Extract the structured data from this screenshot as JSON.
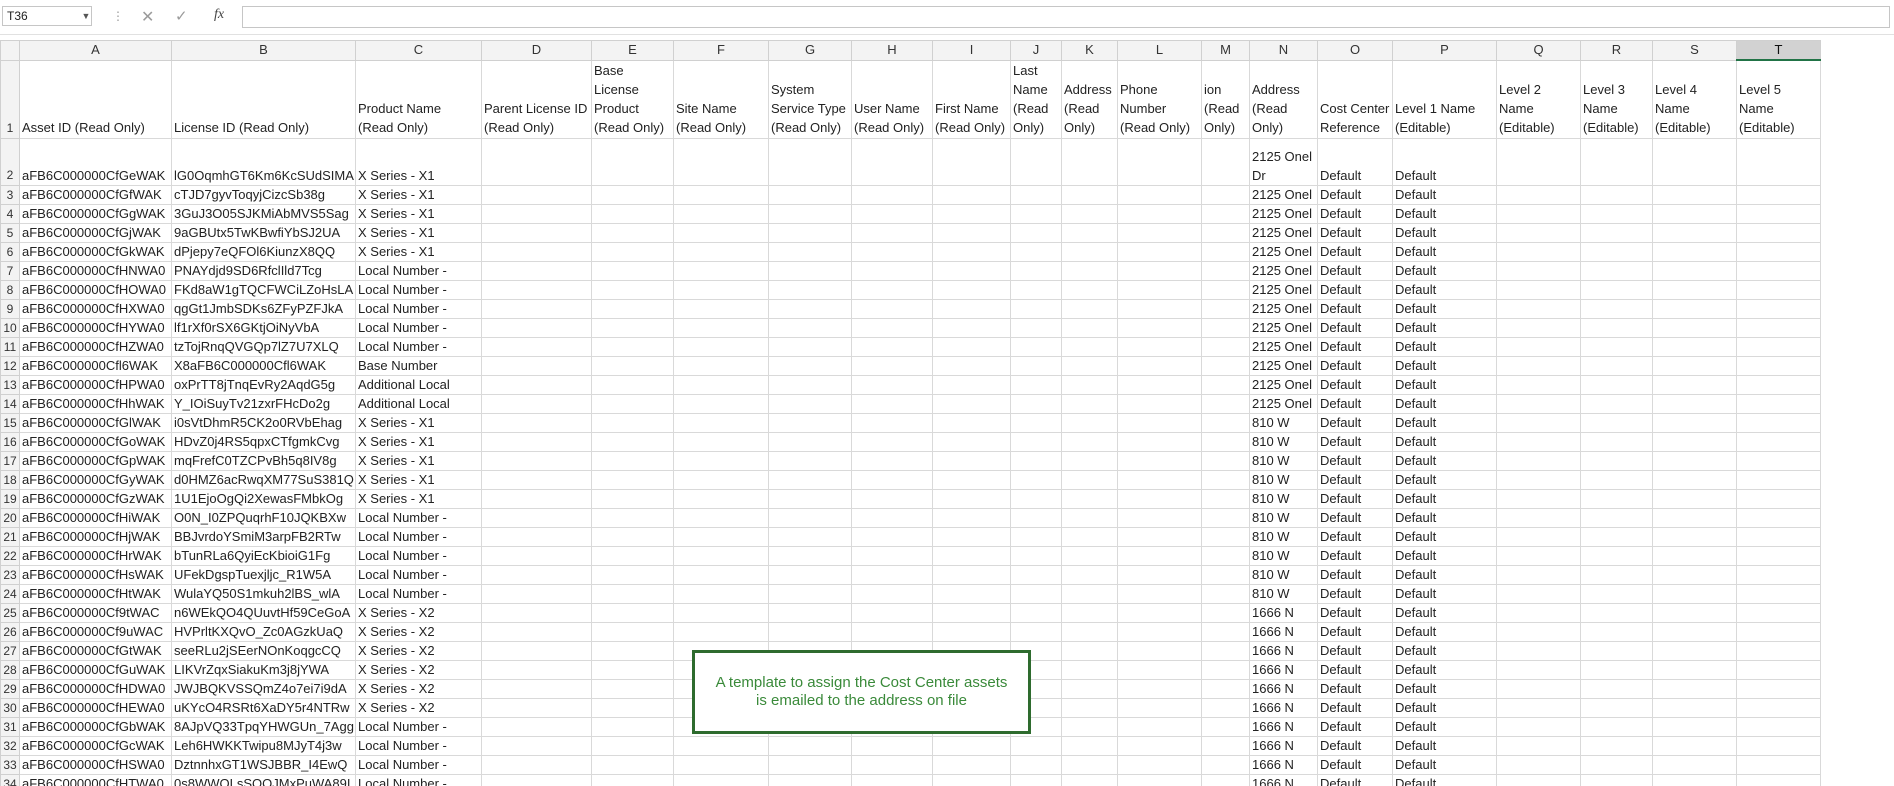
{
  "formula_bar": {
    "name_box": "T36",
    "separator": "⋮",
    "formula": ""
  },
  "icons": {
    "cancel": "close-icon",
    "enter": "check-icon",
    "function": "fx-icon"
  },
  "columns": [
    "A",
    "B",
    "C",
    "D",
    "E",
    "F",
    "G",
    "H",
    "I",
    "J",
    "K",
    "L",
    "M",
    "N",
    "O",
    "P",
    "Q",
    "R",
    "S",
    "T"
  ],
  "selected_column": "T",
  "headers": [
    "Asset ID (Read Only)",
    "License ID (Read Only)",
    "Product Name (Read Only)",
    "Parent License ID (Read Only)",
    "Base License Product (Read Only)",
    "Site Name (Read Only)",
    "System Service Type (Read Only)",
    "User Name (Read Only)",
    "First Name (Read Only)",
    "Last Name (Read Only)",
    "Address (Read Only)",
    "Phone Number (Read Only)",
    "ion (Read Only)",
    "Address (Read Only)",
    "Cost Center Reference",
    "Level 1 Name (Editable)",
    "Level 2 Name (Editable)",
    "Level 3 Name (Editable)",
    "Level 4 Name (Editable)",
    "Level 5 Name (Editable)"
  ],
  "rows": [
    {
      "n": "2",
      "a": "aFB6C000000CfGeWAK",
      "b": "lG0OqmhGT6Km6KcSUdSIMA",
      "c": "X Series - X1",
      "addr": "2125 Onel Dr",
      "cc": "Default",
      "l1": "Default"
    },
    {
      "n": "3",
      "a": "aFB6C000000CfGfWAK",
      "b": "cTJD7gyvToqyjCizcSb38g",
      "c": "X Series - X1",
      "addr": "2125 Onel",
      "cc": "Default",
      "l1": "Default"
    },
    {
      "n": "4",
      "a": "aFB6C000000CfGgWAK",
      "b": "3GuJ3O05SJKMiAbMVS5Sag",
      "c": "X Series - X1",
      "addr": "2125 Onel",
      "cc": "Default",
      "l1": "Default"
    },
    {
      "n": "5",
      "a": "aFB6C000000CfGjWAK",
      "b": "9aGBUtx5TwKBwfiYbSJ2UA",
      "c": "X Series - X1",
      "addr": "2125 Onel",
      "cc": "Default",
      "l1": "Default"
    },
    {
      "n": "6",
      "a": "aFB6C000000CfGkWAK",
      "b": "dPjepy7eQFOl6KiunzX8QQ",
      "c": "X Series - X1",
      "addr": "2125 Onel",
      "cc": "Default",
      "l1": "Default"
    },
    {
      "n": "7",
      "a": "aFB6C000000CfHNWA0",
      "b": "PNAYdjd9SD6RfclIld7Tcg",
      "c": "Local Number -",
      "addr": "2125 Onel",
      "cc": "Default",
      "l1": "Default"
    },
    {
      "n": "8",
      "a": "aFB6C000000CfHOWA0",
      "b": "FKd8aW1gTQCFWCiLZoHsLA",
      "c": "Local Number -",
      "addr": "2125 Onel",
      "cc": "Default",
      "l1": "Default"
    },
    {
      "n": "9",
      "a": "aFB6C000000CfHXWA0",
      "b": "qgGt1JmbSDKs6ZFyPZFJkA",
      "c": "Local Number -",
      "addr": "2125 Onel",
      "cc": "Default",
      "l1": "Default"
    },
    {
      "n": "10",
      "a": "aFB6C000000CfHYWA0",
      "b": "lf1rXf0rSX6GKtjOiNyVbA",
      "c": "Local Number -",
      "addr": "2125 Onel",
      "cc": "Default",
      "l1": "Default"
    },
    {
      "n": "11",
      "a": "aFB6C000000CfHZWA0",
      "b": "tzTojRnqQVGQp7lZ7U7XLQ",
      "c": "Local Number -",
      "addr": "2125 Onel",
      "cc": "Default",
      "l1": "Default"
    },
    {
      "n": "12",
      "a": "aFB6C000000Cfl6WAK",
      "b": "X8aFB6C000000Cfl6WAK",
      "c": "Base Number",
      "addr": "2125 Onel",
      "cc": "Default",
      "l1": "Default"
    },
    {
      "n": "13",
      "a": "aFB6C000000CfHPWA0",
      "b": "oxPrTT8jTnqEvRy2AqdG5g",
      "c": "Additional Local",
      "addr": "2125 Onel",
      "cc": "Default",
      "l1": "Default"
    },
    {
      "n": "14",
      "a": "aFB6C000000CfHhWAK",
      "b": "Y_IOiSuyTv21zxrFHcDo2g",
      "c": "Additional Local",
      "addr": "2125 Onel",
      "cc": "Default",
      "l1": "Default"
    },
    {
      "n": "15",
      "a": "aFB6C000000CfGlWAK",
      "b": "i0sVtDhmR5CK2o0RVbEhag",
      "c": "X Series - X1",
      "addr": "810 W",
      "cc": "Default",
      "l1": "Default"
    },
    {
      "n": "16",
      "a": "aFB6C000000CfGoWAK",
      "b": "HDvZ0j4RS5qpxCTfgmkCvg",
      "c": "X Series - X1",
      "addr": "810 W",
      "cc": "Default",
      "l1": "Default"
    },
    {
      "n": "17",
      "a": "aFB6C000000CfGpWAK",
      "b": "mqFrefC0TZCPvBh5q8IV8g",
      "c": "X Series - X1",
      "addr": "810 W",
      "cc": "Default",
      "l1": "Default"
    },
    {
      "n": "18",
      "a": "aFB6C000000CfGyWAK",
      "b": "d0HMZ6acRwqXM77SuS381Q",
      "c": "X Series - X1",
      "addr": "810 W",
      "cc": "Default",
      "l1": "Default"
    },
    {
      "n": "19",
      "a": "aFB6C000000CfGzWAK",
      "b": "1U1EjoOgQi2XewasFMbkOg",
      "c": "X Series - X1",
      "addr": "810 W",
      "cc": "Default",
      "l1": "Default"
    },
    {
      "n": "20",
      "a": "aFB6C000000CfHiWAK",
      "b": "O0N_I0ZPQuqrhF10JQKBXw",
      "c": "Local Number -",
      "addr": "810 W",
      "cc": "Default",
      "l1": "Default"
    },
    {
      "n": "21",
      "a": "aFB6C000000CfHjWAK",
      "b": "BBJvrdoYSmiM3arpFB2RTw",
      "c": "Local Number -",
      "addr": "810 W",
      "cc": "Default",
      "l1": "Default"
    },
    {
      "n": "22",
      "a": "aFB6C000000CfHrWAK",
      "b": "bTunRLa6QyiEcKbioiG1Fg",
      "c": "Local Number -",
      "addr": "810 W",
      "cc": "Default",
      "l1": "Default"
    },
    {
      "n": "23",
      "a": "aFB6C000000CfHsWAK",
      "b": "UFekDgspTuexjljc_R1W5A",
      "c": "Local Number -",
      "addr": "810 W",
      "cc": "Default",
      "l1": "Default"
    },
    {
      "n": "24",
      "a": "aFB6C000000CfHtWAK",
      "b": "WulaYQ50S1mkuh2lBS_wlA",
      "c": "Local Number -",
      "addr": "810 W",
      "cc": "Default",
      "l1": "Default"
    },
    {
      "n": "25",
      "a": "aFB6C000000Cf9tWAC",
      "b": "n6WEkQO4QUuvtHf59CeGoA",
      "c": "X Series - X2",
      "addr": "1666 N",
      "cc": "Default",
      "l1": "Default"
    },
    {
      "n": "26",
      "a": "aFB6C000000Cf9uWAC",
      "b": "HVPrltKXQvO_Zc0AGzkUaQ",
      "c": "X Series - X2",
      "addr": "1666 N",
      "cc": "Default",
      "l1": "Default"
    },
    {
      "n": "27",
      "a": "aFB6C000000CfGtWAK",
      "b": "seeRLu2jSEerNOnKoqgcCQ",
      "c": "X Series - X2",
      "addr": "1666 N",
      "cc": "Default",
      "l1": "Default"
    },
    {
      "n": "28",
      "a": "aFB6C000000CfGuWAK",
      "b": "LIKVrZqxSiakuKm3j8jYWA",
      "c": "X Series - X2",
      "addr": "1666 N",
      "cc": "Default",
      "l1": "Default"
    },
    {
      "n": "29",
      "a": "aFB6C000000CfHDWA0",
      "b": "JWJBQKVSSQmZ4o7ei7i9dA",
      "c": "X Series - X2",
      "addr": "1666 N",
      "cc": "Default",
      "l1": "Default"
    },
    {
      "n": "30",
      "a": "aFB6C000000CfHEWA0",
      "b": "uKYcO4RSRt6XaDY5r4NTRw",
      "c": "X Series - X2",
      "addr": "1666 N",
      "cc": "Default",
      "l1": "Default"
    },
    {
      "n": "31",
      "a": "aFB6C000000CfGbWAK",
      "b": "8AJpVQ33TpqYHWGUn_7Agg",
      "c": "Local Number -",
      "addr": "1666 N",
      "cc": "Default",
      "l1": "Default"
    },
    {
      "n": "32",
      "a": "aFB6C000000CfGcWAK",
      "b": "Leh6HWKKTwipu8MJyT4j3w",
      "c": "Local Number -",
      "addr": "1666 N",
      "cc": "Default",
      "l1": "Default"
    },
    {
      "n": "33",
      "a": "aFB6C000000CfHSWA0",
      "b": "DztnnhxGT1WSJBBR_I4EwQ",
      "c": "Local Number -",
      "addr": "1666 N",
      "cc": "Default",
      "l1": "Default"
    },
    {
      "n": "34",
      "a": "aFB6C000000CfHTWA0",
      "b": "0s8WWOLsSQOJMxPuWA89I",
      "c": "Local Number -",
      "addr": "1666 N",
      "cc": "Default",
      "l1": "Default"
    }
  ],
  "note_box": {
    "text": "A template to assign the Cost Center assets is emailed to the address on file"
  },
  "colors": {
    "header_bg": "#f3f3f3",
    "grid_line": "#d9d9d9",
    "selected_header_bg": "#d2d2d2",
    "excel_green": "#217346",
    "note_border": "#2e6b2e",
    "note_text": "#3a8a3a"
  }
}
